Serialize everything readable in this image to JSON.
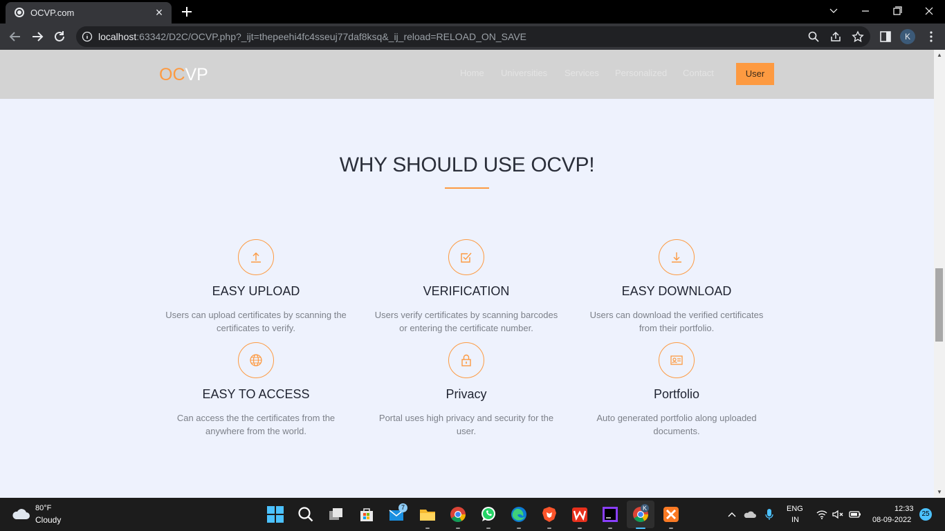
{
  "browser": {
    "tab_title": "OCVP.com",
    "tab_close": "×",
    "url_host": "localhost",
    "url_rest": ":63342/D2C/OCVP.php?_ijt=thepeehi4fc4sseuj77daf8ksq&_ij_reload=RELOAD_ON_SAVE",
    "profile_initial": "K"
  },
  "site": {
    "logo_oc": "OC",
    "logo_vp": "VP",
    "menu": [
      "Home",
      "Universities",
      "Services",
      "Personalized",
      "Contact"
    ],
    "user_button": "User",
    "accent_color": "#fd9a41"
  },
  "section": {
    "title": "WHY SHOULD USE OCVP!",
    "features": [
      {
        "icon": "upload-icon",
        "title": "EASY UPLOAD",
        "desc_line1": "Users can upload certificates by scanning the",
        "desc_line2": "certificates to verify."
      },
      {
        "icon": "check-square-icon",
        "title": "VERIFICATION",
        "desc_line1": "Users verify certificates by scanning barcodes",
        "desc_line2": "or entering the certificate number."
      },
      {
        "icon": "download-icon",
        "title": "EASY DOWNLOAD",
        "desc_line1": "Users can download the verified certificates",
        "desc_line2": "from their portfolio."
      },
      {
        "icon": "globe-icon",
        "title": "EASY TO ACCESS",
        "desc_line1": "Can access the the certificates from the",
        "desc_line2": "anywhere from the world."
      },
      {
        "icon": "lock-icon",
        "title": "Privacy",
        "desc_line1": "Portal uses high privacy and security for the",
        "desc_line2": "user."
      },
      {
        "icon": "id-card-icon",
        "title": "Portfolio",
        "desc_line1": "Auto generated portfolio along uploaded",
        "desc_line2": "documents."
      }
    ]
  },
  "taskbar": {
    "weather_temp": "80°F",
    "weather_cond": "Cloudy",
    "mail_badge": "7",
    "chrome_profile_badge": "K",
    "lang_line1": "ENG",
    "lang_line2": "IN",
    "time": "12:33",
    "date": "08-09-2022",
    "notification_count": "25"
  }
}
